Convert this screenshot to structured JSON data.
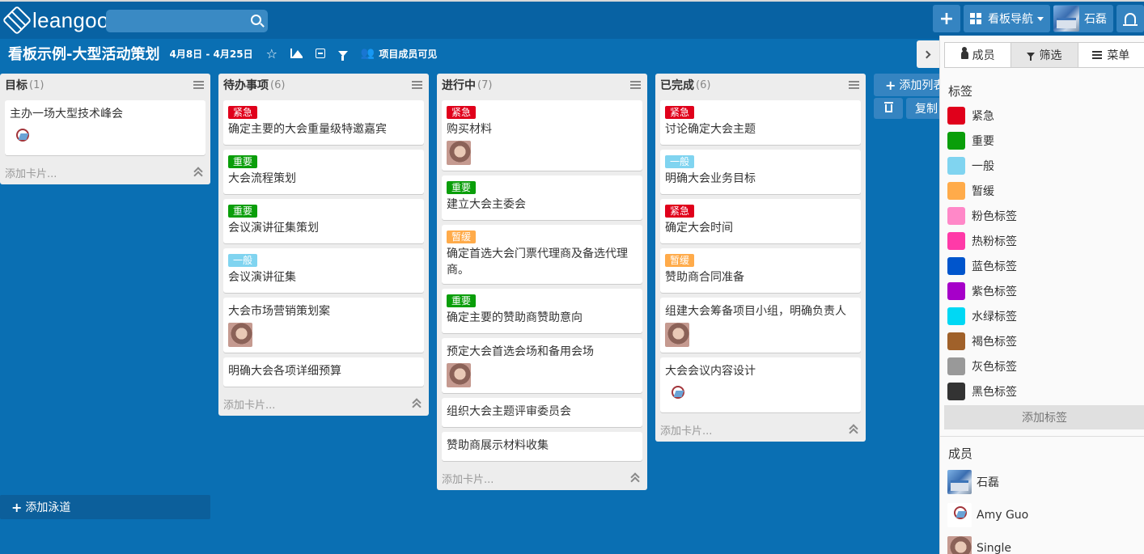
{
  "app": {
    "logo_text": "leangoo"
  },
  "search": {
    "placeholder": ""
  },
  "topbar": {
    "board_nav_label": "看板导航",
    "user_name": "石磊"
  },
  "board": {
    "title": "看板示例-大型活动策划",
    "dates": "4月8日 - 4月25日",
    "visibility": "项目成员可见"
  },
  "lists": [
    {
      "title": "目标",
      "count": "(1)",
      "add_card": "添加卡片...",
      "cards": [
        {
          "title": "主办一场大型技术峰会",
          "avatar": "logo"
        }
      ]
    },
    {
      "title": "待办事项",
      "count": "(6)",
      "add_card": "添加卡片...",
      "cards": [
        {
          "label": "紧急",
          "label_color": "#e0001b",
          "title": "确定主要的大会重量级特邀嘉宾"
        },
        {
          "label": "重要",
          "label_color": "#0a9e0a",
          "title": "大会流程策划"
        },
        {
          "label": "重要",
          "label_color": "#0a9e0a",
          "title": "会议演讲征集策划"
        },
        {
          "label": "一般",
          "label_color": "#80d4f0",
          "title": "会议演讲征集"
        },
        {
          "title": "大会市场营销策划案",
          "avatar": "face"
        },
        {
          "title": "明确大会各项详细预算"
        }
      ]
    },
    {
      "title": "进行中",
      "count": "(7)",
      "add_card": "添加卡片...",
      "cards": [
        {
          "label": "紧急",
          "label_color": "#e0001b",
          "title": "购买材料",
          "avatar": "face"
        },
        {
          "label": "重要",
          "label_color": "#0a9e0a",
          "title": "建立大会主委会"
        },
        {
          "label": "暂缓",
          "label_color": "#ffab4a",
          "title": "确定首选大会门票代理商及备选代理商。"
        },
        {
          "label": "重要",
          "label_color": "#0a9e0a",
          "title": "确定主要的赞助商赞助意向"
        },
        {
          "title": "预定大会首选会场和备用会场",
          "avatar": "face"
        },
        {
          "title": "组织大会主题评审委员会"
        },
        {
          "title": "赞助商展示材料收集"
        }
      ]
    },
    {
      "title": "已完成",
      "count": "(6)",
      "add_card": "添加卡片...",
      "cards": [
        {
          "label": "紧急",
          "label_color": "#e0001b",
          "title": "讨论确定大会主题"
        },
        {
          "label": "一般",
          "label_color": "#80d4f0",
          "title": "明确大会业务目标"
        },
        {
          "label": "紧急",
          "label_color": "#e0001b",
          "title": "确定大会时间"
        },
        {
          "label": "暂缓",
          "label_color": "#ffab4a",
          "title": "赞助商合同准备"
        },
        {
          "title": "组建大会筹备项目小组，明确负责人",
          "avatar": "face"
        },
        {
          "title": "大会会议内容设计",
          "avatar": "logo"
        }
      ]
    }
  ],
  "add_lane": "添加泳道",
  "add_list": "添加列表",
  "copy": "复制",
  "panel": {
    "tabs": [
      "成员",
      "筛选",
      "菜单"
    ],
    "tags_title": "标签",
    "tags": [
      {
        "name": "紧急",
        "color": "#e0001b"
      },
      {
        "name": "重要",
        "color": "#0a9e0a"
      },
      {
        "name": "一般",
        "color": "#80d4f0"
      },
      {
        "name": "暂缓",
        "color": "#ffab4a"
      },
      {
        "name": "粉色标签",
        "color": "#ff88c8"
      },
      {
        "name": "热粉标签",
        "color": "#ff3aa8"
      },
      {
        "name": "蓝色标签",
        "color": "#0055cc"
      },
      {
        "name": "紫色标签",
        "color": "#a600c9"
      },
      {
        "name": "水绿标签",
        "color": "#00d8f4"
      },
      {
        "name": "褐色标签",
        "color": "#a0612a"
      },
      {
        "name": "灰色标签",
        "color": "#999999"
      },
      {
        "name": "黑色标签",
        "color": "#333333"
      }
    ],
    "add_tag": "添加标签",
    "members_title": "成员",
    "members": [
      {
        "name": "石磊",
        "avatar": "photo"
      },
      {
        "name": "Amy Guo",
        "avatar": "logo"
      },
      {
        "name": "Single",
        "avatar": "face"
      }
    ]
  }
}
